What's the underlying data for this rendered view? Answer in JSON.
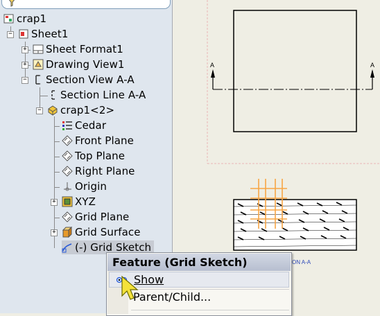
{
  "tree": {
    "filter_icon": "funnel-icon",
    "items": [
      {
        "label": "crap1",
        "icon": "drawing-icon"
      },
      {
        "label": "Sheet1",
        "icon": "sheet-icon"
      },
      {
        "label": "Sheet Format1",
        "icon": "sheet-format-icon"
      },
      {
        "label": "Drawing View1",
        "icon": "drawing-view-icon"
      },
      {
        "label": "Section View A-A",
        "icon": "section-view-icon"
      },
      {
        "label": "Section Line A-A",
        "icon": "section-line-icon"
      },
      {
        "label": "crap1<2>",
        "icon": "part-icon"
      },
      {
        "label": "Cedar",
        "icon": "material-icon"
      },
      {
        "label": "Front Plane",
        "icon": "plane-icon"
      },
      {
        "label": "Top Plane",
        "icon": "plane-icon"
      },
      {
        "label": "Right Plane",
        "icon": "plane-icon"
      },
      {
        "label": "Origin",
        "icon": "origin-icon"
      },
      {
        "label": "XYZ",
        "icon": "feature-icon"
      },
      {
        "label": "Grid Plane",
        "icon": "plane-icon"
      },
      {
        "label": "Grid Surface",
        "icon": "surface-icon"
      },
      {
        "label": "(-) Grid Sketch",
        "icon": "sketch-icon"
      }
    ]
  },
  "canvas": {
    "section_label_left": "A",
    "section_label_right": "A",
    "view_caption": "ON A-A"
  },
  "context_menu": {
    "title": "Feature (Grid Sketch)",
    "items": [
      {
        "label": "Show",
        "icon": "show-eye-icon",
        "mnemonic": "S"
      },
      {
        "label": "Parent/Child...",
        "icon": "",
        "mnemonic": "P"
      }
    ]
  },
  "colors": {
    "tree_bg": "#dfe6ee",
    "canvas_bg": "#efeee4",
    "sketch_orange": "#f7a545",
    "sheet_border_pink": "#e8b6b6"
  }
}
